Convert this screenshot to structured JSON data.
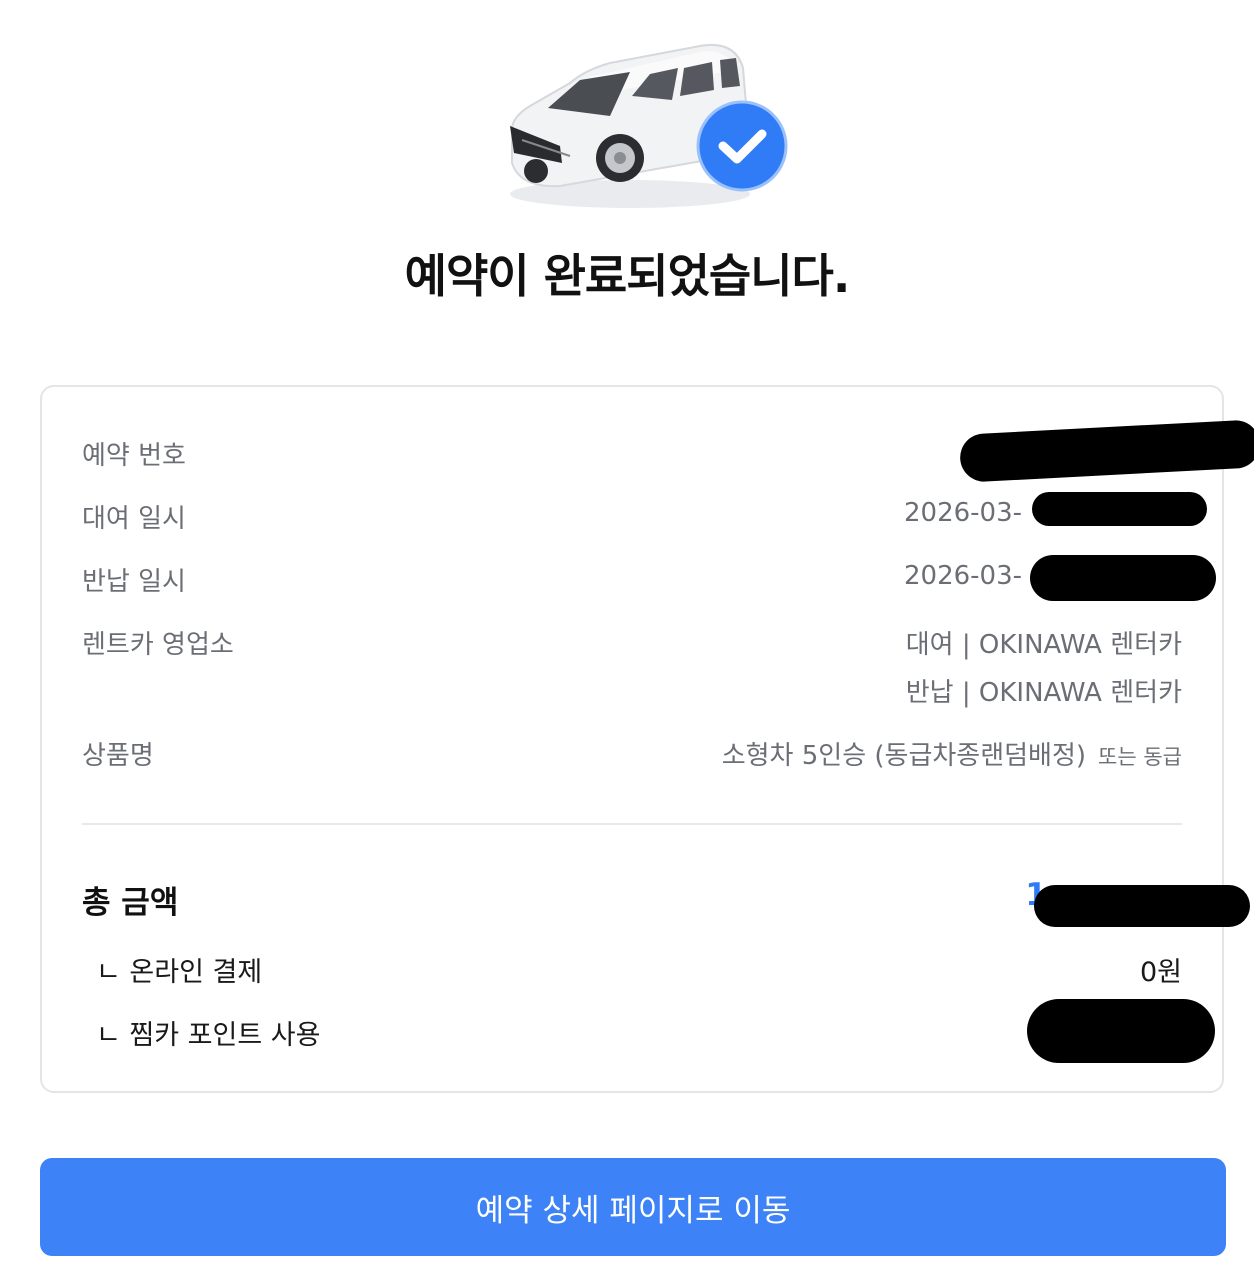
{
  "title": "예약이 완료되었습니다.",
  "details": {
    "reservation_number_label": "예약 번호",
    "pickup_label": "대여 일시",
    "pickup_value": "2026-03-",
    "return_label": "반납 일시",
    "return_value": "2026-03-",
    "office_label": "렌트카 영업소",
    "office_pickup": "대여 | OKINAWA 렌터카",
    "office_return": "반납 | OKINAWA 렌터카",
    "product_label": "상품명",
    "product_value": "소형차 5인승 (동급차종랜덤배정)",
    "product_suffix": "또는 동급"
  },
  "payment": {
    "total_label": "총 금액",
    "total_value": "1",
    "online_label": "ㄴ 온라인 결제",
    "online_value": "0원",
    "points_label": "ㄴ 찜카 포인트 사용"
  },
  "cta_label": "예약 상세 페이지로 이동",
  "colors": {
    "accent": "#3d82f6",
    "check_badge": "#2f7cf6",
    "muted_text": "#6b6f75",
    "border": "#e3e5e8"
  },
  "icons": {
    "hero": "car-icon",
    "badge": "check-icon"
  }
}
